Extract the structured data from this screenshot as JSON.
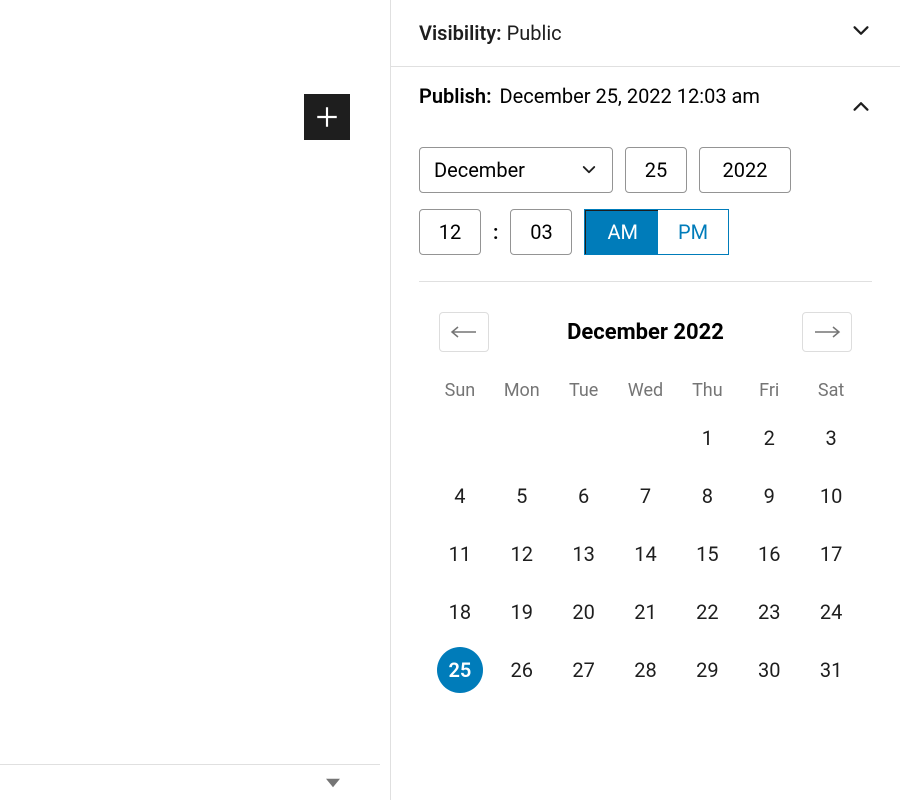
{
  "visibility": {
    "label": "Visibility:",
    "value": "Public"
  },
  "publish": {
    "label": "Publish:",
    "value": "December 25, 2022 12:03 am",
    "month": "December",
    "day": "25",
    "year": "2022",
    "hour": "12",
    "minute": "03",
    "am_label": "AM",
    "pm_label": "PM",
    "meridiem": "AM"
  },
  "calendar": {
    "title": "December 2022",
    "dow": [
      "Sun",
      "Mon",
      "Tue",
      "Wed",
      "Thu",
      "Fri",
      "Sat"
    ],
    "leading_blanks": 4,
    "days_in_month": 31,
    "selected_day": 25
  }
}
